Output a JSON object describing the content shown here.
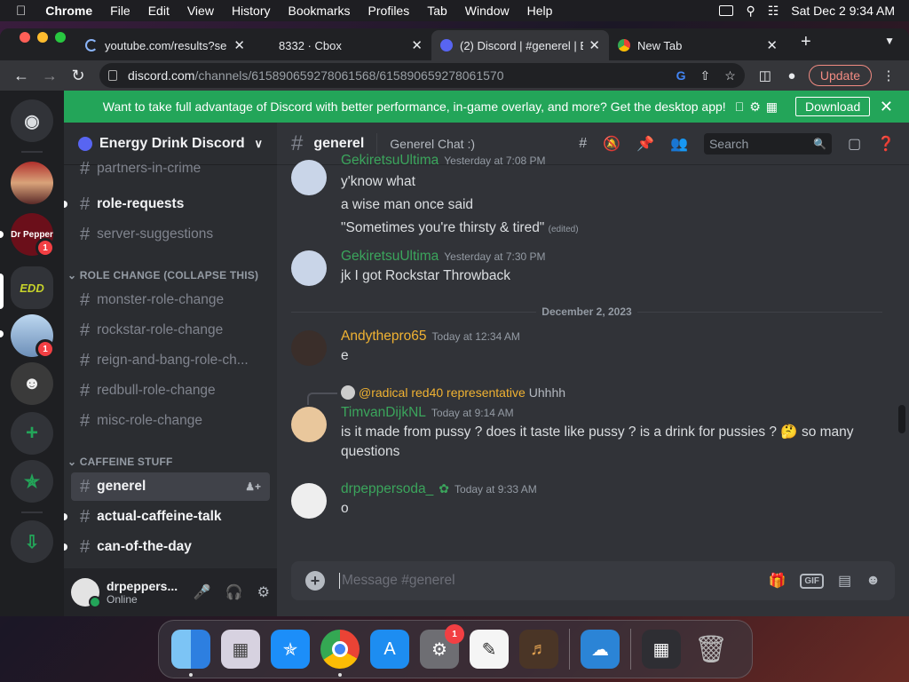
{
  "menubar": {
    "app": "Chrome",
    "items": [
      "File",
      "Edit",
      "View",
      "History",
      "Bookmarks",
      "Profiles",
      "Tab",
      "Window",
      "Help"
    ],
    "clock": "Sat Dec 2  9:34 AM"
  },
  "tabs": [
    {
      "title": "youtube.com/results?se",
      "active": false
    },
    {
      "title": "8332 · Cbox",
      "active": false
    },
    {
      "title": "(2) Discord | #generel | E",
      "active": true
    },
    {
      "title": "New Tab",
      "active": false
    }
  ],
  "address": {
    "host": "discord.com",
    "path": "/channels/615890659278061568/615890659278061570"
  },
  "update_label": "Update",
  "banner": {
    "text": "Want to take full advantage of Discord with better performance, in-game overlay, and more? Get the desktop app!",
    "button": "Download"
  },
  "servers": {
    "badges": [
      "1",
      "1"
    ],
    "labels": {
      "dr_pepper": "Dr Pepper",
      "edd": "EDD"
    }
  },
  "guild": {
    "name": "Energy Drink Discord"
  },
  "channels": {
    "top": [
      {
        "name": "partners-in-crime",
        "unread": false
      },
      {
        "name": "role-requests",
        "unread": true
      },
      {
        "name": "server-suggestions",
        "unread": false
      }
    ],
    "cat1": "ROLE CHANGE (COLLAPSE THIS)",
    "role": [
      {
        "name": "monster-role-change"
      },
      {
        "name": "rockstar-role-change"
      },
      {
        "name": "reign-and-bang-role-ch..."
      },
      {
        "name": "redbull-role-change"
      },
      {
        "name": "misc-role-change"
      }
    ],
    "cat2": "CAFFEINE STUFF",
    "caffeine": [
      {
        "name": "generel",
        "selected": true
      },
      {
        "name": "actual-caffeine-talk",
        "unread": true
      },
      {
        "name": "can-of-the-day",
        "unread": true
      }
    ]
  },
  "user": {
    "name": "drpeppers...",
    "status": "Online"
  },
  "chat": {
    "channel": "generel",
    "topic": "Generel Chat :)",
    "search_placeholder": "Search",
    "date_divider": "December 2, 2023",
    "composer_placeholder": "Message #generel",
    "gif_label": "GIF"
  },
  "messages": {
    "m1": {
      "author": "GekiretsuUltima",
      "time": "Yesterday at 7:08 PM",
      "lines": [
        "y'know what",
        "a wise man once said",
        "\"Sometimes you're thirsty & tired\""
      ],
      "edited": "(edited)",
      "color": "#3ba55c"
    },
    "m2": {
      "author": "GekiretsuUltima",
      "time": "Yesterday at 7:30 PM",
      "lines": [
        "jk I got Rockstar Throwback"
      ],
      "color": "#3ba55c"
    },
    "m3": {
      "author": "Andythepro65",
      "time": "Today at 12:34 AM",
      "lines": [
        "e"
      ],
      "color": "#f0b232"
    },
    "m4": {
      "reply_mention": "@radical red40 representative",
      "reply_text": "Uhhhh",
      "author": "TimvanDijkNL",
      "time": "Today at 9:14 AM",
      "lines": [
        "is it made from pussy ? does it taste like pussy ? is a drink for pussies ? 🤔 so many",
        "questions"
      ],
      "color": "#3ba55c"
    },
    "m5": {
      "author": "drpeppersoda_",
      "time": "Today at 9:33 AM",
      "lines": [
        "o"
      ],
      "color": "#3ba55c"
    }
  },
  "dock_badge": "1"
}
